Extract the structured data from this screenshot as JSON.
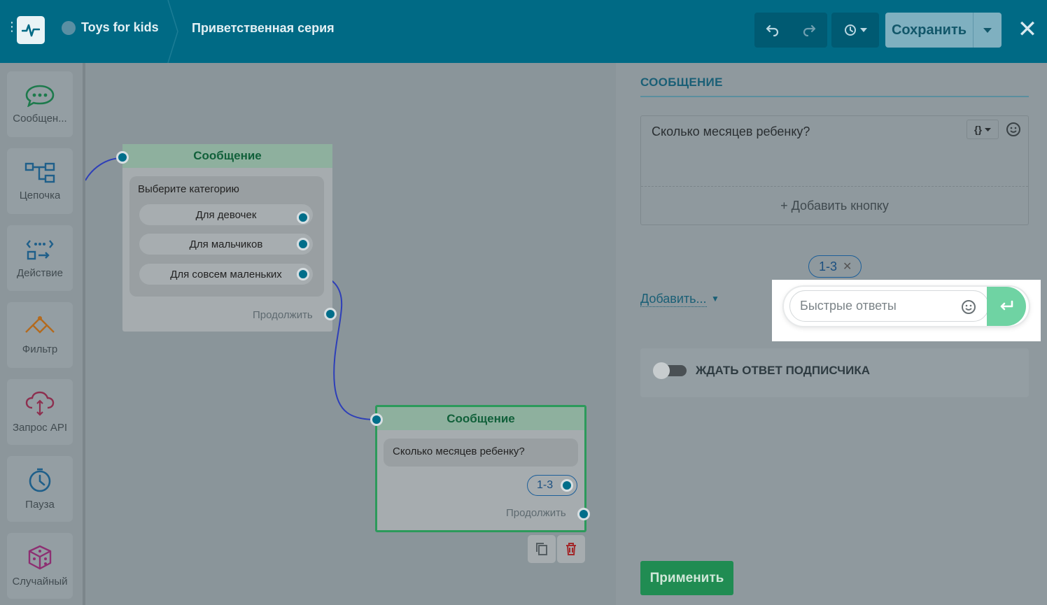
{
  "header": {
    "bot_name": "Toys for kids",
    "flow_name": "Приветственная серия",
    "save_label": "Сохранить"
  },
  "toolbox": [
    {
      "label": "Сообщен...",
      "icon": "chat-icon"
    },
    {
      "label": "Цепочка",
      "icon": "chain-icon"
    },
    {
      "label": "Действие",
      "icon": "action-icon"
    },
    {
      "label": "Фильтр",
      "icon": "filter-icon"
    },
    {
      "label": "Запрос API",
      "icon": "cloud-api-icon"
    },
    {
      "label": "Пауза",
      "icon": "clock-icon"
    },
    {
      "label": "Случайный",
      "icon": "dice-icon"
    }
  ],
  "canvas": {
    "node1": {
      "title": "Сообщение",
      "text": "Выберите категорию",
      "options": [
        "Для девочек",
        "Для мальчиков",
        "Для совсем маленьких"
      ],
      "continue": "Продолжить"
    },
    "node2": {
      "title": "Сообщение",
      "text": "Сколько месяцев ребенку?",
      "quick_reply": "1-3",
      "continue": "Продолжить"
    }
  },
  "panel": {
    "title": "СООБЩЕНИЕ",
    "message_text": "Сколько месяцев ребенку?",
    "var_button": "{}",
    "add_button_label": "+ Добавить кнопку",
    "quick_reply_chip": "1-3",
    "add_dropdown": "Добавить...",
    "quick_replies_placeholder": "Быстрые ответы",
    "wait_label": "ЖДАТЬ ОТВЕТ ПОДПИСЧИКА",
    "wait_enabled": false,
    "apply_label": "Применить"
  },
  "colors": {
    "header": "#006a85",
    "accent_green": "#208c52",
    "port": "#006e8a",
    "send_button": "#6fd3a3"
  }
}
